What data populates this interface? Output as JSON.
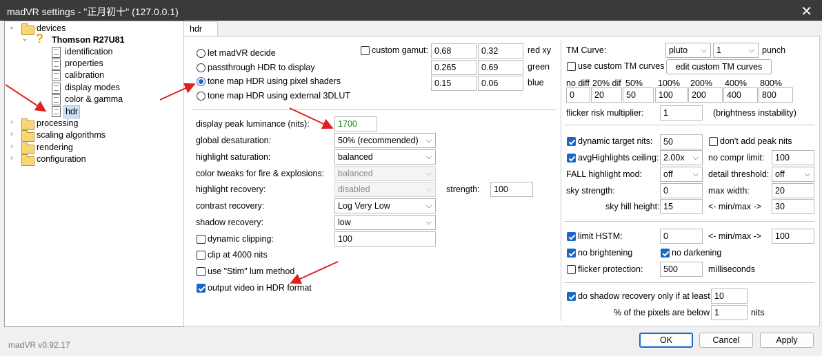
{
  "window": {
    "title": "madVR settings - \"正月初十\" (127.0.0.1)",
    "close_label": "✕"
  },
  "tree": {
    "devices": "devices",
    "device": "Thomson R27U81",
    "identification": "identification",
    "properties": "properties",
    "calibration": "calibration",
    "display_modes": "display modes",
    "color_gamma": "color & gamma",
    "hdr": "hdr",
    "processing": "processing",
    "scaling": "scaling algorithms",
    "rendering": "rendering",
    "configuration": "configuration"
  },
  "version": "madVR v0.92.17",
  "tab": "hdr",
  "hdr_mode": {
    "options": [
      "let madVR decide",
      "passthrough HDR to display",
      "tone map HDR using pixel shaders",
      "tone map HDR using external 3DLUT"
    ],
    "selected": 2
  },
  "gamut": {
    "label": "custom gamut:",
    "checked": false,
    "rows": [
      {
        "a": "0.68",
        "b": "0.32",
        "label": "red xy"
      },
      {
        "a": "0.265",
        "b": "0.69",
        "label": "green"
      },
      {
        "a": "0.15",
        "b": "0.06",
        "label": "blue"
      }
    ]
  },
  "settings": {
    "peak_label": "display peak luminance (nits):",
    "peak_value": "1700",
    "desat_label": "global desaturation:",
    "desat_value": "50% (recommended)",
    "hl_sat_label": "highlight saturation:",
    "hl_sat_value": "balanced",
    "fire_label": "color tweaks for fire & explosions:",
    "fire_value": "balanced",
    "hl_rec_label": "highlight recovery:",
    "hl_rec_value": "disabled",
    "strength_label": "strength:",
    "strength_value": "100",
    "contrast_label": "contrast recovery:",
    "contrast_value": "Log Very Low",
    "shadow_label": "shadow recovery:",
    "shadow_value": "low",
    "dyn_clip_label": "dynamic clipping:",
    "dyn_clip_value": "100",
    "dyn_clip_checked": false,
    "clip4000_label": "clip at 4000 nits",
    "clip4000_checked": false,
    "stim_label": "use \"Stim\" lum method",
    "stim_checked": false,
    "output_label": "output video in HDR format",
    "output_checked": true
  },
  "tm": {
    "curve_label": "TM Curve:",
    "curve_value": "pluto",
    "punch_value": "1",
    "punch_label": "punch",
    "custom_label": "use custom TM curves",
    "custom_checked": false,
    "edit_button": "edit custom TM curves",
    "diffs": [
      {
        "label": "no diff",
        "value": "0"
      },
      {
        "label": "20% dif",
        "value": "20"
      },
      {
        "label": "50%",
        "value": "50"
      },
      {
        "label": "100%",
        "value": "100"
      },
      {
        "label": "200%",
        "value": "200"
      },
      {
        "label": "400%",
        "value": "400"
      },
      {
        "label": "800%",
        "value": "800"
      }
    ],
    "flicker_label": "flicker risk multiplier:",
    "flicker_value": "1",
    "flicker_note": "(brightness instability)"
  },
  "dynamic": {
    "dtn_label": "dynamic target nits:",
    "dtn_value": "50",
    "dtn_checked": true,
    "peak_label": "don't add peak nits",
    "peak_checked": false,
    "avg_label": "avgHighlights ceiling:",
    "avg_value": "2.00x",
    "avg_checked": true,
    "nocompr_label": "no compr limit:",
    "nocompr_value": "100",
    "fall_label": "FALL highlight mod:",
    "fall_value": "off",
    "detail_label": "detail threshold:",
    "detail_value": "off",
    "sky_label": "sky strength:",
    "sky_value": "0",
    "maxw_label": "max width:",
    "maxw_value": "20",
    "hill_label": "sky hill height:",
    "hill_value": "15",
    "minmax_label": "<- min/max ->",
    "minmax_value": "30"
  },
  "hstm": {
    "limit_label": "limit HSTM:",
    "limit_value": "0",
    "limit_checked": true,
    "minmax_label": "<- min/max ->",
    "minmax_value": "100",
    "nobright_label": "no brightening",
    "nobright_checked": true,
    "nodark_label": "no darkening",
    "nodark_checked": true,
    "flickp_label": "flicker protection:",
    "flickp_value": "500",
    "flickp_checked": false,
    "ms_label": "milliseconds"
  },
  "shadow_only": {
    "label": "do shadow recovery only if at least",
    "value": "10",
    "checked": true,
    "pct_label": "% of the pixels are below",
    "pct_value": "1",
    "nits_label": "nits"
  },
  "buttons": {
    "ok": "OK",
    "cancel": "Cancel",
    "apply": "Apply"
  },
  "colors": {
    "accent": "#1a67c8",
    "peak_text": "#1a8a1a",
    "annotation_arrow": "#e02020"
  }
}
